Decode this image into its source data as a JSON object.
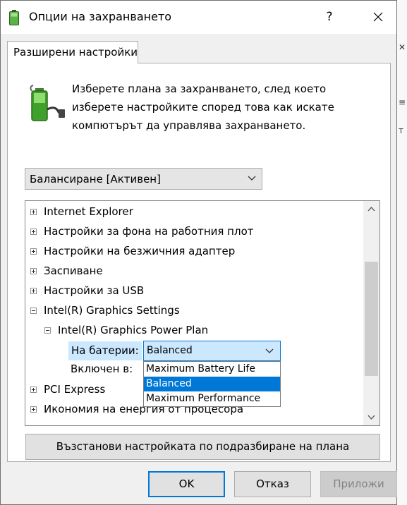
{
  "window": {
    "title": "Опции на захранването",
    "help_label": "?",
    "icon": "power-options-icon",
    "close_icon": "close-icon"
  },
  "tab": {
    "label": "Разширени настройки"
  },
  "description": {
    "lines": [
      "Изберете плана за захранването, след което",
      "изберете настройките според това как искате",
      "компютърът да управлява захранването."
    ],
    "icon": "battery-plug-icon"
  },
  "plan_select": {
    "value": "Балансиране [Активен]"
  },
  "tree": {
    "items": [
      {
        "label": "Internet Explorer",
        "state": "collapsed"
      },
      {
        "label": "Настройки за фона на работния плот",
        "state": "collapsed"
      },
      {
        "label": "Настройки на безжичния адаптер",
        "state": "collapsed"
      },
      {
        "label": "Заспиване",
        "state": "collapsed"
      },
      {
        "label": "Настройки за USB",
        "state": "collapsed"
      },
      {
        "label": "Intel(R) Graphics Settings",
        "state": "expanded"
      },
      {
        "label": "Intel(R) Graphics Power Plan",
        "state": "expanded"
      },
      {
        "label": "PCI Express",
        "state": "collapsed"
      },
      {
        "label": "Икономия на енергия от процесора",
        "state": "collapsed"
      }
    ],
    "on_battery_label": "На батерии:",
    "on_battery_value": "Balanced",
    "plugged_in_label": "Включен в:",
    "options": [
      "Maximum Battery Life",
      "Balanced",
      "Maximum Performance"
    ],
    "selected_option": "Balanced"
  },
  "buttons": {
    "restore": "Възстанови настройката по подразбиране на плана",
    "ok": "OK",
    "cancel": "Отказ",
    "apply": "Приложи"
  },
  "colors": {
    "accent": "#0078d7",
    "selection_light": "#cce8ff",
    "dialog_bg": "#f0f0f0"
  }
}
